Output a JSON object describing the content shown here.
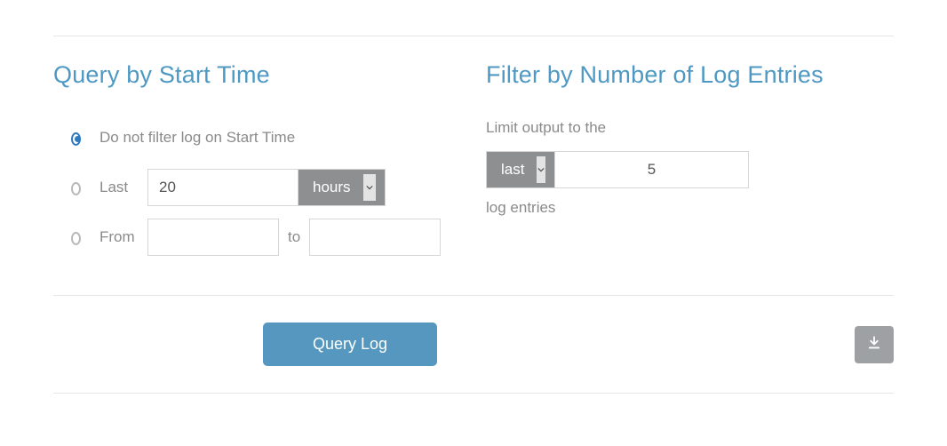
{
  "left": {
    "heading": "Query by Start Time",
    "options": {
      "no_filter": {
        "label": "Do not filter log on Start Time"
      },
      "last": {
        "label": "Last",
        "value": "20",
        "unit_selected": "hours"
      },
      "range": {
        "label": "From",
        "from_value": "",
        "to_label": "to",
        "to_value": ""
      }
    }
  },
  "right": {
    "heading": "Filter by Number of Log Entries",
    "intro": "Limit output to the",
    "direction_selected": "last",
    "count_value": "5",
    "trailing": "log entries"
  },
  "actions": {
    "query_label": "Query Log"
  }
}
